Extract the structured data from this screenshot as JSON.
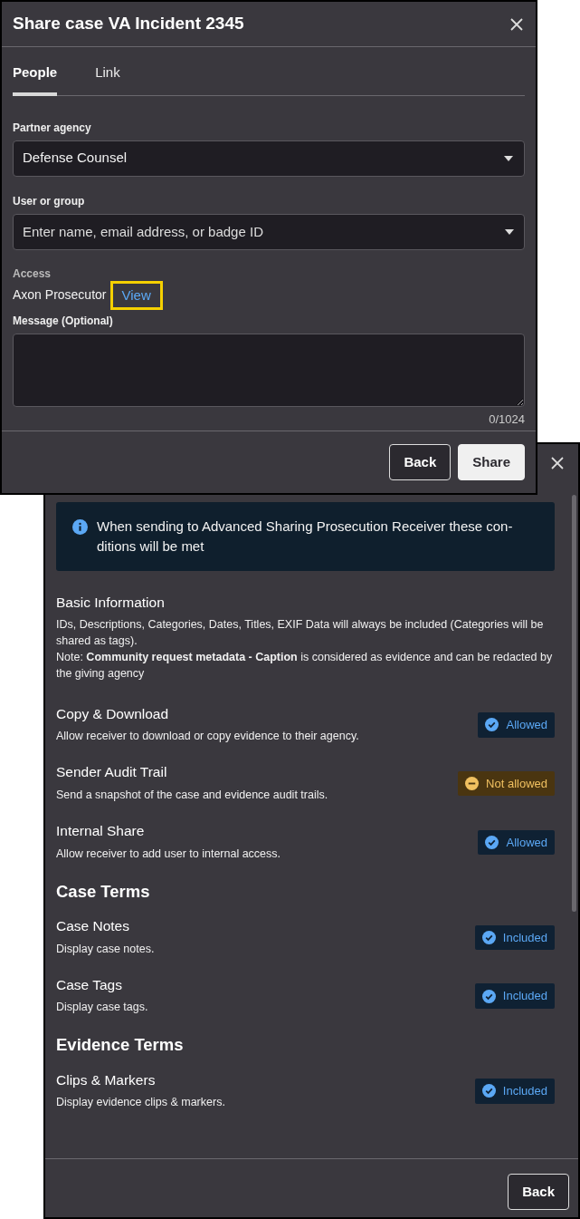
{
  "share_dialog": {
    "title": "Share case VA Incident 2345",
    "tabs": [
      {
        "label": "People",
        "selected": true
      },
      {
        "label": "Link",
        "selected": false
      }
    ],
    "partner_agency": {
      "label": "Partner agency",
      "value": "Defense Counsel"
    },
    "user_or_group": {
      "label": "User or group",
      "placeholder": "Enter name, email address, or badge ID"
    },
    "access": {
      "label": "Access",
      "value": "Axon Prosecutor",
      "link": "View",
      "link_highlighted": true
    },
    "message": {
      "label": "Message (Optional)",
      "counter": "0/1024"
    },
    "buttons": [
      {
        "label": "Back",
        "kind": "secondary"
      },
      {
        "label": "Share",
        "kind": "primary"
      }
    ]
  },
  "terms_dialog": {
    "alert": "When sending to Advanced Sharing Prosecution Receiver these con-ditions will be met",
    "blocks": [
      {
        "kind": "info",
        "title": "Basic Information",
        "text": "IDs, Descriptions, Categories, Dates, Titles, EXIF Data will always be included (Categories will be shared as tags).",
        "note": "Note: **Community request metadata - Caption** is considered as evidence and can be redacted by the giving agency"
      },
      {
        "kind": "term",
        "title": "Copy & Download",
        "text": "Allow receiver to download or copy evidence to their agency.",
        "status": "Allowed",
        "positive": true
      },
      {
        "kind": "term",
        "title": "Sender Audit Trail",
        "text": "Send a snapshot of the case and evidence audit trails.",
        "status": "Not allowed",
        "positive": false
      },
      {
        "kind": "term",
        "title": "Internal Share",
        "text": "Allow receiver to add user to internal access.",
        "status": "Allowed",
        "positive": true
      },
      {
        "kind": "heading",
        "title": "Case Terms"
      },
      {
        "kind": "term",
        "title": "Case Notes",
        "text": "Display case notes.",
        "status": "Included",
        "positive": true
      },
      {
        "kind": "term",
        "title": "Case Tags",
        "text": "Display case tags.",
        "status": "Included",
        "positive": true
      },
      {
        "kind": "heading",
        "title": "Evidence Terms"
      },
      {
        "kind": "term",
        "title": "Clips & Markers",
        "text": "Display evidence clips & markers.",
        "status": "Included",
        "positive": true
      }
    ],
    "buttons": [
      {
        "label": "Back",
        "kind": "secondary"
      }
    ]
  }
}
